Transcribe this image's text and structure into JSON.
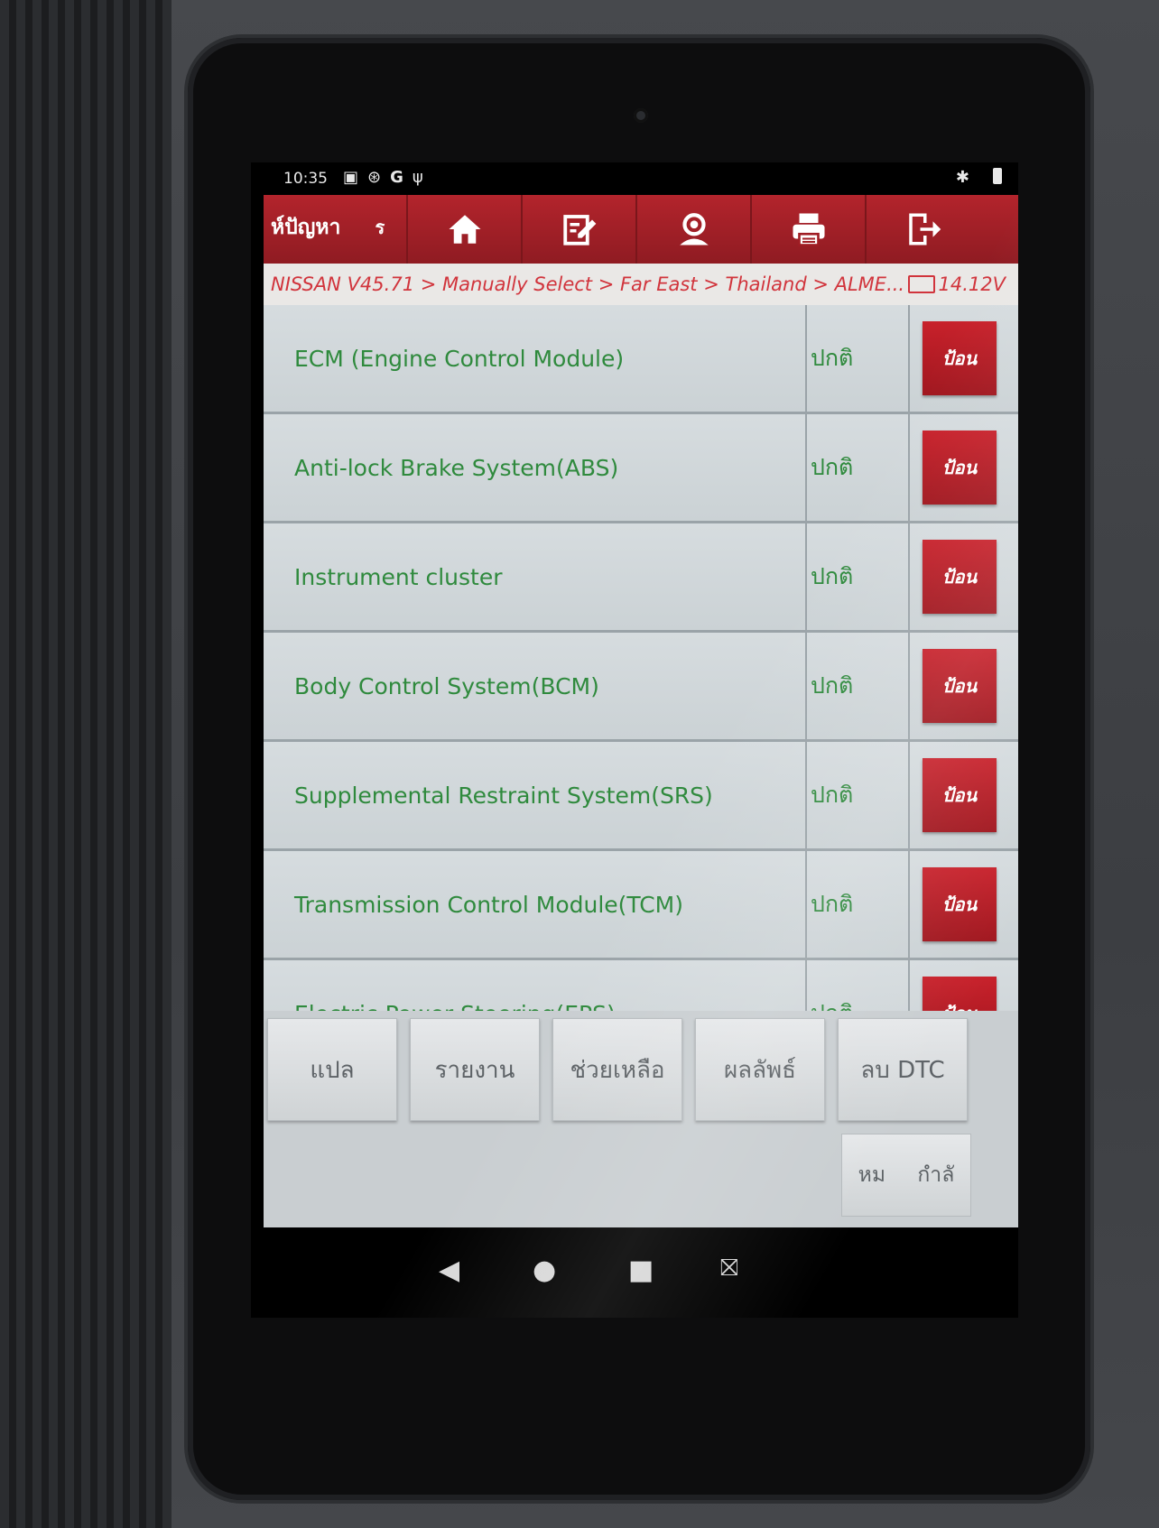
{
  "status_bar": {
    "time": "10:35",
    "left_icons": [
      "image-icon",
      "settings-dial-icon",
      "google-g-icon",
      "usb-icon"
    ],
    "right_icons": [
      "bluetooth-icon",
      "battery-icon"
    ]
  },
  "toolbar": {
    "title": "ห์ปัญหา",
    "title_extra": "ร",
    "buttons": [
      {
        "name": "home-icon"
      },
      {
        "name": "edit-icon"
      },
      {
        "name": "user-icon"
      },
      {
        "name": "print-icon"
      },
      {
        "name": "exit-icon"
      }
    ]
  },
  "breadcrumb": {
    "path": "NISSAN V45.71 > Manually Select > Far East > Thailand > ALME...",
    "voltage": "14.12V"
  },
  "systems": [
    {
      "name": "ECM (Engine Control Module)",
      "status": "ปกติ",
      "action": "ป้อน"
    },
    {
      "name": "Anti-lock Brake System(ABS)",
      "status": "ปกติ",
      "action": "ป้อน"
    },
    {
      "name": "Instrument cluster",
      "status": "ปกติ",
      "action": "ป้อน"
    },
    {
      "name": "Body Control System(BCM)",
      "status": "ปกติ",
      "action": "ป้อน"
    },
    {
      "name": "Supplemental Restraint System(SRS)",
      "status": "ปกติ",
      "action": "ป้อน"
    },
    {
      "name": "Transmission Control Module(TCM)",
      "status": "ปกติ",
      "action": "ป้อน"
    },
    {
      "name": "Electric Power Steering(EPS)",
      "status": "ปกติ",
      "action": "ป้อน"
    }
  ],
  "actions": {
    "translate": "แปล",
    "report": "รายงาน",
    "help": "ช่วยเหลือ",
    "results": "ผลลัพธ์",
    "clear_dtc": "ลบ DTC",
    "more_left": "หม",
    "more_right": "กำลั"
  },
  "colors": {
    "toolbar_red": "#b3242c",
    "breadcrumb_red": "#d1343c",
    "system_green": "#2f8a3d",
    "enter_red": "#c8212b"
  }
}
